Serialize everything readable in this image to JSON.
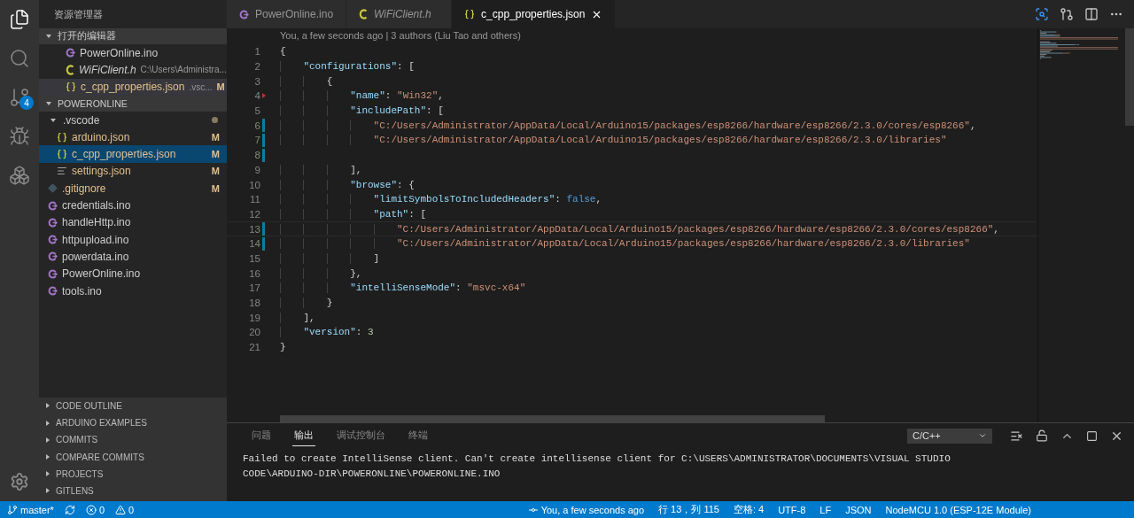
{
  "activity_bar": {
    "items": [
      {
        "kind": "files",
        "selected": true
      },
      {
        "kind": "search",
        "selected": false
      },
      {
        "kind": "scm",
        "selected": false,
        "badge": "4"
      },
      {
        "kind": "debug",
        "selected": false
      },
      {
        "kind": "extensions",
        "selected": false
      }
    ]
  },
  "sidebar": {
    "title": "资源管理器",
    "open_editors": {
      "label": "打开的编辑器",
      "expanded": true,
      "items": [
        {
          "kind": "ino",
          "name": "PowerOnline.ino",
          "italic": false,
          "modified": false,
          "selected": false
        },
        {
          "kind": "c",
          "name": "WiFiClient.h",
          "description": "C:\\Users\\Administra...",
          "italic": true,
          "modified": false,
          "selected": false
        },
        {
          "kind": "json",
          "name": "c_cpp_properties.json",
          "description": ".vsc...",
          "badge": "M",
          "italic": false,
          "modified": true,
          "selected": true
        }
      ]
    },
    "folder": {
      "label": "POWERONLINE",
      "expanded": true,
      "items": [
        {
          "name": ".vscode",
          "expanded": true,
          "dot": true,
          "modified": false,
          "selected": false,
          "children": [
            {
              "kind": "json",
              "name": "arduino.json",
              "badge": "M",
              "modified": true,
              "selected": false
            },
            {
              "kind": "json",
              "name": "c_cpp_properties.json",
              "badge": "M",
              "modified": true,
              "selected": true
            },
            {
              "kind": "settings",
              "name": "settings.json",
              "badge": "M",
              "modified": true,
              "selected": false
            }
          ]
        },
        {
          "kind": "git",
          "name": ".gitignore",
          "badge": "M",
          "modified": true,
          "selected": false
        },
        {
          "kind": "ino",
          "name": "credentials.ino",
          "modified": false,
          "selected": false
        },
        {
          "kind": "ino",
          "name": "handleHttp.ino",
          "modified": false,
          "selected": false
        },
        {
          "kind": "ino",
          "name": "httpupload.ino",
          "modified": false,
          "selected": false
        },
        {
          "kind": "ino",
          "name": "powerdata.ino",
          "modified": false,
          "selected": false
        },
        {
          "kind": "ino",
          "name": "PowerOnline.ino",
          "modified": false,
          "selected": false
        },
        {
          "kind": "ino",
          "name": "tools.ino",
          "modified": false,
          "selected": false
        }
      ]
    },
    "sections": [
      {
        "label": "CODE OUTLINE",
        "expanded": false
      },
      {
        "label": "ARDUINO EXAMPLES",
        "expanded": false
      },
      {
        "label": "COMMITS",
        "expanded": false
      },
      {
        "label": "COMPARE COMMITS",
        "expanded": false
      },
      {
        "label": "PROJECTS",
        "expanded": false
      },
      {
        "label": "GITLENS",
        "expanded": false
      }
    ]
  },
  "tabs": [
    {
      "kind": "ino",
      "label": "PowerOnline.ino",
      "italic": false,
      "selected": false
    },
    {
      "kind": "c",
      "label": "WiFiClient.h",
      "italic": true,
      "selected": false
    },
    {
      "kind": "json",
      "label": "c_cpp_properties.json",
      "italic": false,
      "selected": true
    }
  ],
  "editor": {
    "blame": "You, a few seconds ago | 3 authors (Liu Tao and others)",
    "lines": [
      {
        "num": "1",
        "modified": false,
        "deleted": false,
        "current": false,
        "tokens": [
          {
            "kind": "punct",
            "text": "{"
          }
        ]
      },
      {
        "num": "2",
        "modified": false,
        "deleted": false,
        "current": false,
        "tokens": [
          {
            "kind": "key",
            "text": "    \"configurations\""
          },
          {
            "kind": "punct",
            "text": ": ["
          }
        ]
      },
      {
        "num": "3",
        "modified": false,
        "deleted": false,
        "current": false,
        "tokens": [
          {
            "kind": "punct",
            "text": "        {"
          }
        ]
      },
      {
        "num": "4",
        "modified": false,
        "deleted": true,
        "current": false,
        "tokens": [
          {
            "kind": "key",
            "text": "            \"name\""
          },
          {
            "kind": "punct",
            "text": ": "
          },
          {
            "kind": "string",
            "text": "\"Win32\""
          },
          {
            "kind": "punct",
            "text": ","
          }
        ]
      },
      {
        "num": "5",
        "modified": false,
        "deleted": false,
        "current": false,
        "tokens": [
          {
            "kind": "key",
            "text": "            \"includePath\""
          },
          {
            "kind": "punct",
            "text": ": ["
          }
        ]
      },
      {
        "num": "6",
        "modified": true,
        "deleted": false,
        "current": false,
        "tokens": [
          {
            "kind": "string",
            "text": "                \"C:/Users/Administrator/AppData/Local/Arduino15/packages/esp8266/hardware/esp8266/2.3.0/cores/esp8266\""
          },
          {
            "kind": "punct",
            "text": ","
          }
        ]
      },
      {
        "num": "7",
        "modified": true,
        "deleted": false,
        "current": false,
        "tokens": [
          {
            "kind": "string",
            "text": "                \"C:/Users/Administrator/AppData/Local/Arduino15/packages/esp8266/hardware/esp8266/2.3.0/libraries\""
          }
        ]
      },
      {
        "num": "8",
        "modified": true,
        "deleted": false,
        "current": false
      },
      {
        "num": "9",
        "modified": false,
        "deleted": false,
        "current": false,
        "tokens": [
          {
            "kind": "punct",
            "text": "            ],"
          }
        ]
      },
      {
        "num": "10",
        "modified": false,
        "deleted": false,
        "current": false,
        "tokens": [
          {
            "kind": "key",
            "text": "            \"browse\""
          },
          {
            "kind": "punct",
            "text": ": {"
          }
        ]
      },
      {
        "num": "11",
        "modified": false,
        "deleted": false,
        "current": false,
        "tokens": [
          {
            "kind": "key",
            "text": "                \"limitSymbolsToIncludedHeaders\""
          },
          {
            "kind": "punct",
            "text": ": "
          },
          {
            "kind": "keyword",
            "text": "false"
          },
          {
            "kind": "punct",
            "text": ","
          }
        ]
      },
      {
        "num": "12",
        "modified": false,
        "deleted": false,
        "current": false,
        "tokens": [
          {
            "kind": "key",
            "text": "                \"path\""
          },
          {
            "kind": "punct",
            "text": ": ["
          }
        ]
      },
      {
        "num": "13",
        "modified": true,
        "deleted": false,
        "current": true,
        "tokens": [
          {
            "kind": "string",
            "text": "                    \"C:/Users/Administrator/AppData/Local/Arduino15/packages/esp8266/hardware/esp8266/2.3.0/cores/esp8266\""
          },
          {
            "kind": "punct",
            "text": ","
          }
        ]
      },
      {
        "num": "14",
        "modified": true,
        "deleted": false,
        "current": false,
        "tokens": [
          {
            "kind": "string",
            "text": "                    \"C:/Users/Administrator/AppData/Local/Arduino15/packages/esp8266/hardware/esp8266/2.3.0/libraries\""
          }
        ]
      },
      {
        "num": "15",
        "modified": false,
        "deleted": false,
        "current": false,
        "tokens": [
          {
            "kind": "punct",
            "text": "                ]"
          }
        ]
      },
      {
        "num": "16",
        "modified": false,
        "deleted": false,
        "current": false,
        "tokens": [
          {
            "kind": "punct",
            "text": "            },"
          }
        ]
      },
      {
        "num": "17",
        "modified": false,
        "deleted": false,
        "current": false,
        "tokens": [
          {
            "kind": "key",
            "text": "            \"intelliSenseMode\""
          },
          {
            "kind": "punct",
            "text": ": "
          },
          {
            "kind": "string",
            "text": "\"msvc-x64\""
          }
        ]
      },
      {
        "num": "18",
        "modified": false,
        "deleted": false,
        "current": false,
        "tokens": [
          {
            "kind": "punct",
            "text": "        }"
          }
        ]
      },
      {
        "num": "19",
        "modified": false,
        "deleted": false,
        "current": false,
        "tokens": [
          {
            "kind": "punct",
            "text": "    ],"
          }
        ]
      },
      {
        "num": "20",
        "modified": false,
        "deleted": false,
        "current": false,
        "tokens": [
          {
            "kind": "key",
            "text": "    \"version\""
          },
          {
            "kind": "punct",
            "text": ": "
          },
          {
            "kind": "number",
            "text": "3"
          }
        ]
      },
      {
        "num": "21",
        "modified": false,
        "deleted": false,
        "current": false,
        "tokens": [
          {
            "kind": "punct",
            "text": "}"
          }
        ]
      }
    ]
  },
  "panel": {
    "tabs": [
      {
        "label": "问题",
        "selected": false
      },
      {
        "label": "输出",
        "selected": true
      },
      {
        "label": "调试控制台",
        "selected": false
      },
      {
        "label": "终端",
        "selected": false
      }
    ],
    "channel": "C/C++",
    "output": "Failed to create IntelliSense client. Can't create intellisense client for C:\\USERS\\ADMINISTRATOR\\DOCUMENTS\\VISUAL STUDIO CODE\\ARDUINO-DIR\\POWERONLINE\\POWERONLINE.INO"
  },
  "status_bar": {
    "branch": "master*",
    "errors": "0",
    "warnings": "0",
    "blame": "You, a few seconds ago",
    "position": "行 13，列 115",
    "indent": "空格: 4",
    "encoding": "UTF-8",
    "eol": "LF",
    "language": "JSON",
    "board": "NodeMCU 1.0 (ESP-12E Module)"
  }
}
